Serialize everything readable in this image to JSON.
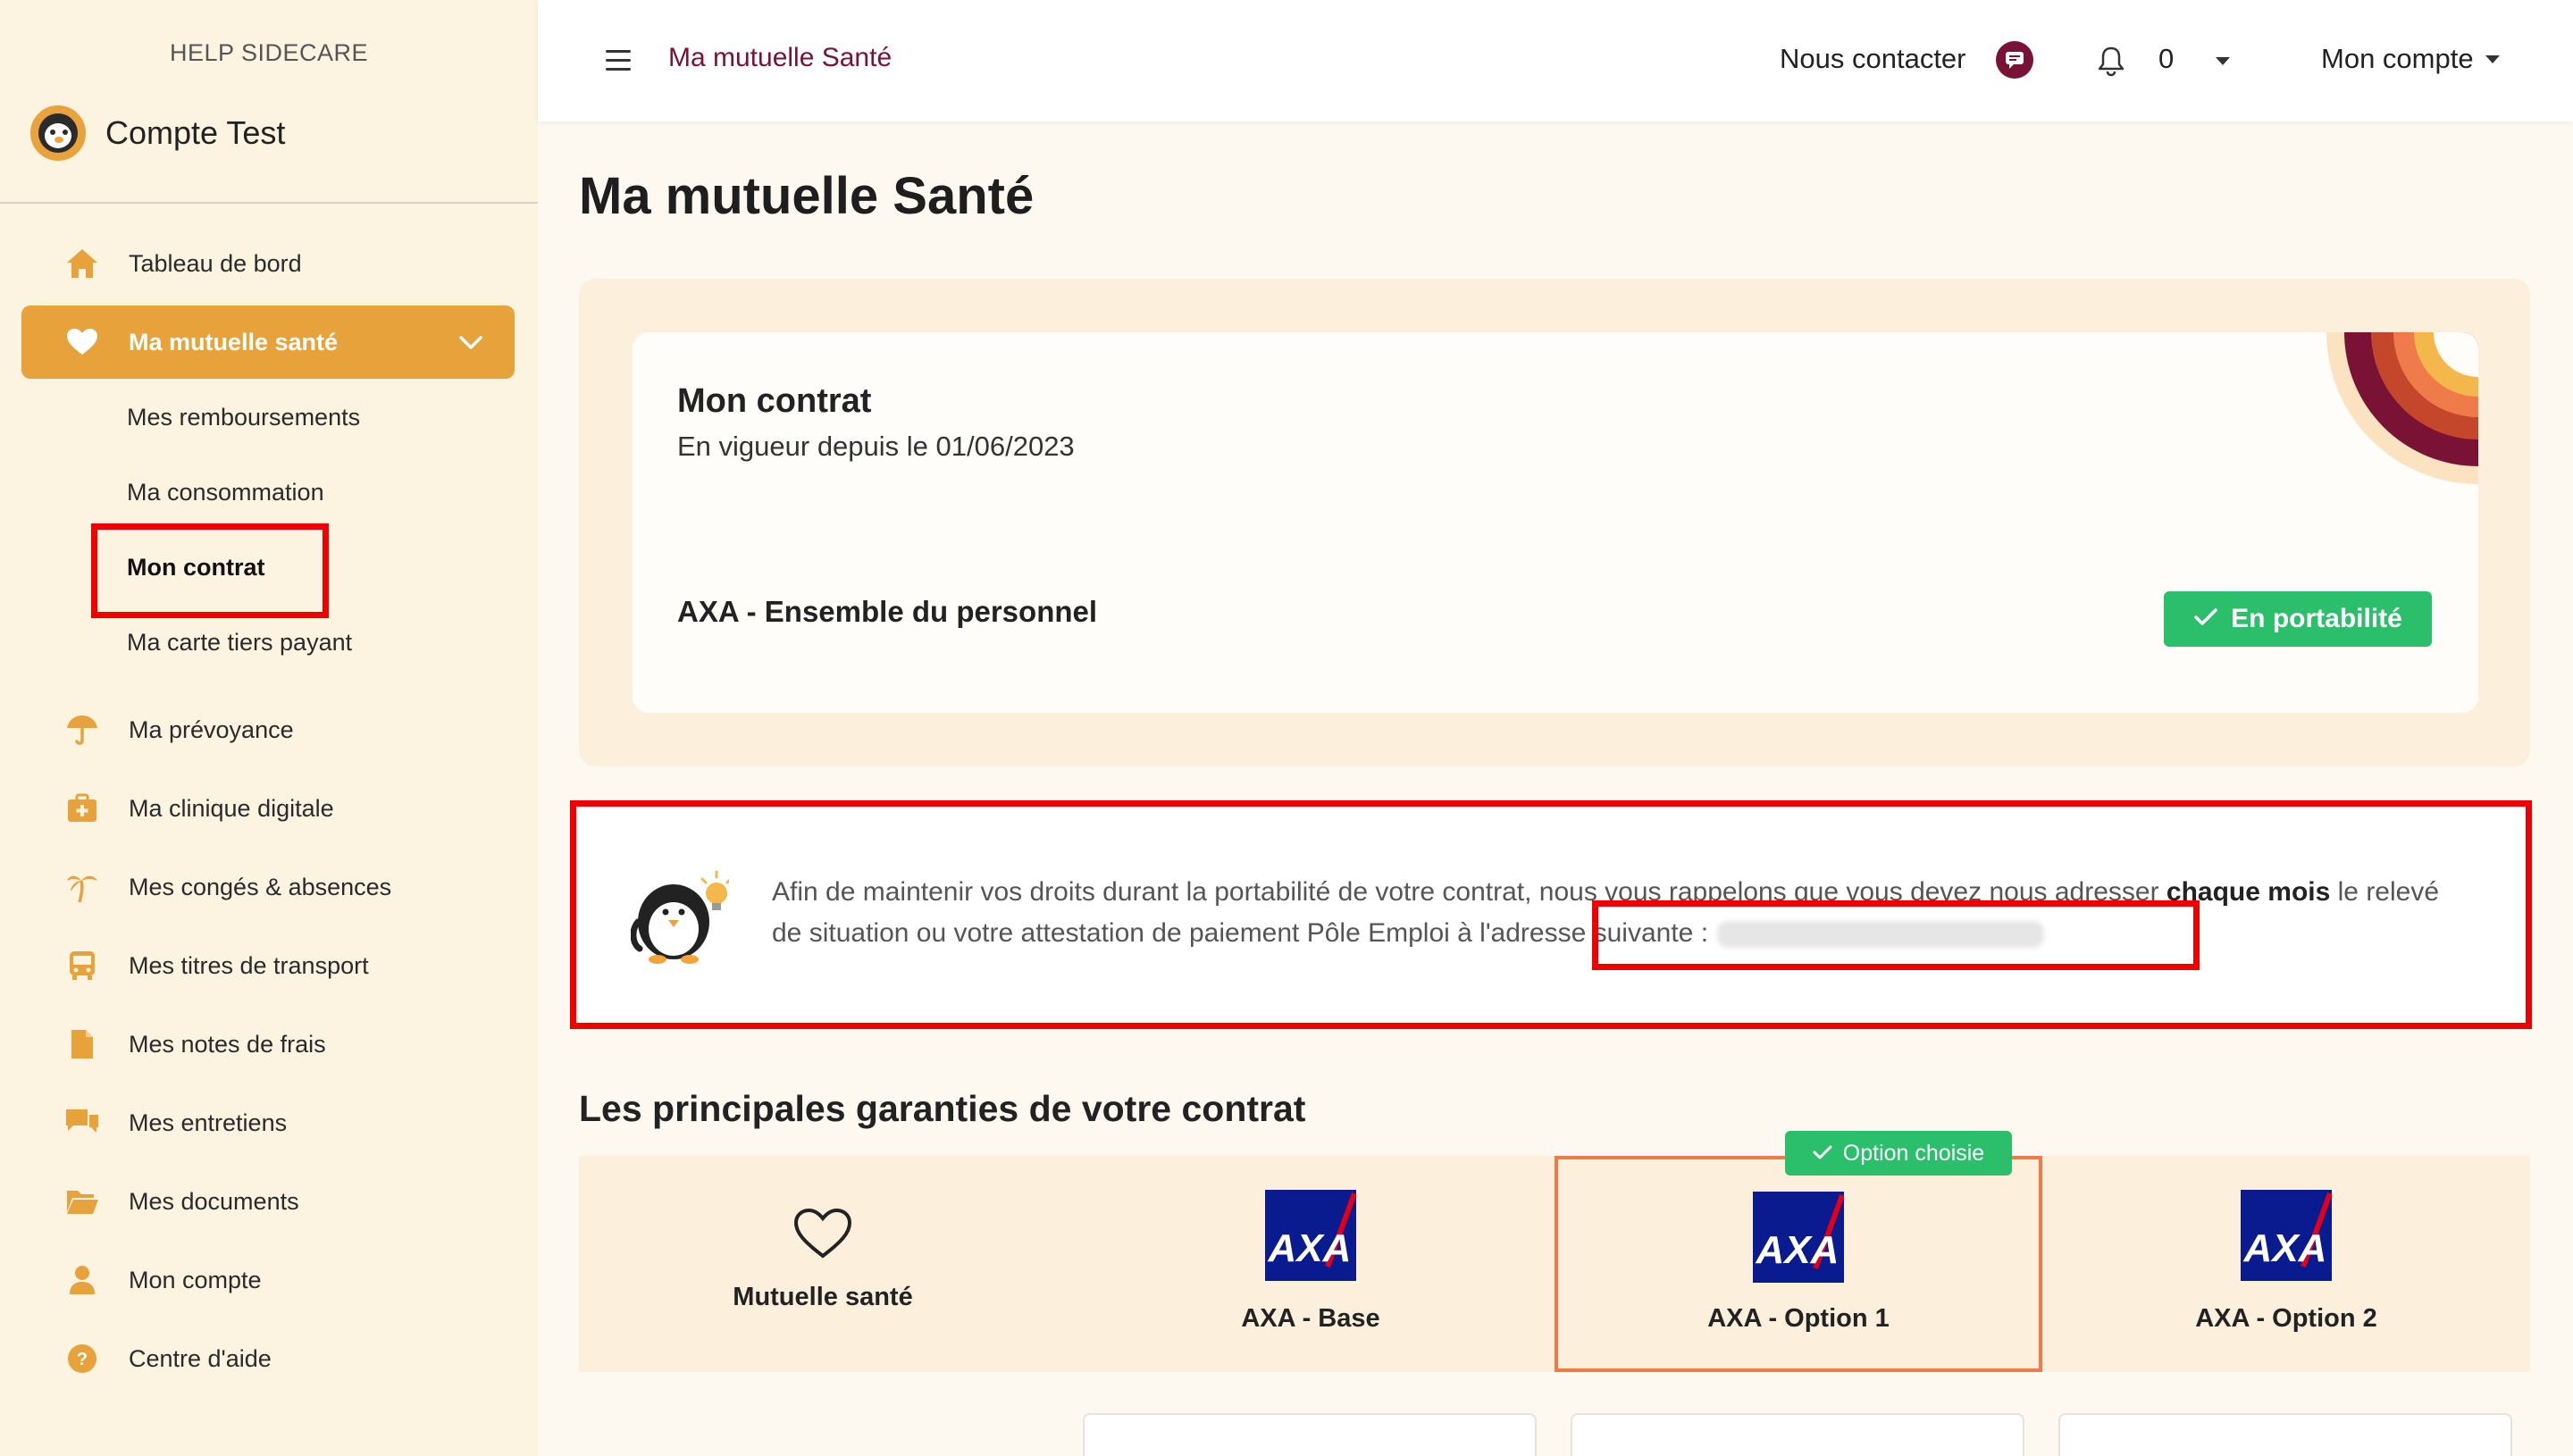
{
  "sidebar": {
    "help_title": "HELP SIDECARE",
    "account_name": "Compte Test",
    "items": [
      {
        "label": "Tableau de bord",
        "icon": "home-icon"
      },
      {
        "label": "Ma mutuelle santé",
        "icon": "heart-icon"
      },
      {
        "label": "Ma prévoyance",
        "icon": "umbrella-icon"
      },
      {
        "label": "Ma clinique digitale",
        "icon": "medical-kit-icon"
      },
      {
        "label": "Mes congés & absences",
        "icon": "palm-tree-icon"
      },
      {
        "label": "Mes titres de transport",
        "icon": "bus-icon"
      },
      {
        "label": "Mes notes de frais",
        "icon": "file-icon"
      },
      {
        "label": "Mes entretiens",
        "icon": "chat-icon"
      },
      {
        "label": "Mes documents",
        "icon": "folder-icon"
      },
      {
        "label": "Mon compte",
        "icon": "user-icon"
      },
      {
        "label": "Centre d'aide",
        "icon": "help-icon"
      }
    ],
    "subitems": [
      {
        "label": "Mes remboursements"
      },
      {
        "label": "Ma consommation"
      },
      {
        "label": "Mon contrat"
      },
      {
        "label": "Ma carte tiers payant"
      }
    ]
  },
  "header": {
    "title": "Ma mutuelle Santé",
    "contact_label": "Nous contacter",
    "notification_count": "0",
    "account_label": "Mon compte"
  },
  "main": {
    "page_title": "Ma mutuelle Santé",
    "contract": {
      "title": "Mon contrat",
      "since": "En vigueur depuis le 01/06/2023",
      "name": "AXA - Ensemble du personnel",
      "status_label": "En portabilité"
    },
    "notice": {
      "text_start": "Afin de maintenir vos droits durant la portabilité de votre contrat, nous vous rappelons que vous devez nous adresser ",
      "text_bold": "chaque mois",
      "text_end": " le relevé de situation ou votre attestation de paiement Pôle Emploi à l'adresse suivante :"
    },
    "guarantees": {
      "title": "Les principales garanties de votre contrat",
      "chosen_badge": "Option choisie",
      "columns": [
        {
          "label": "Mutuelle santé"
        },
        {
          "label": "AXA - Base"
        },
        {
          "label": "AXA - Option 1"
        },
        {
          "label": "AXA - Option 2"
        }
      ],
      "logo_text": "AXA"
    }
  },
  "colors": {
    "accent": "#e8a23c",
    "brand": "#7a1235",
    "success": "#2bbf6c",
    "highlight": "#f00000",
    "selected_border": "#f07b4a"
  }
}
